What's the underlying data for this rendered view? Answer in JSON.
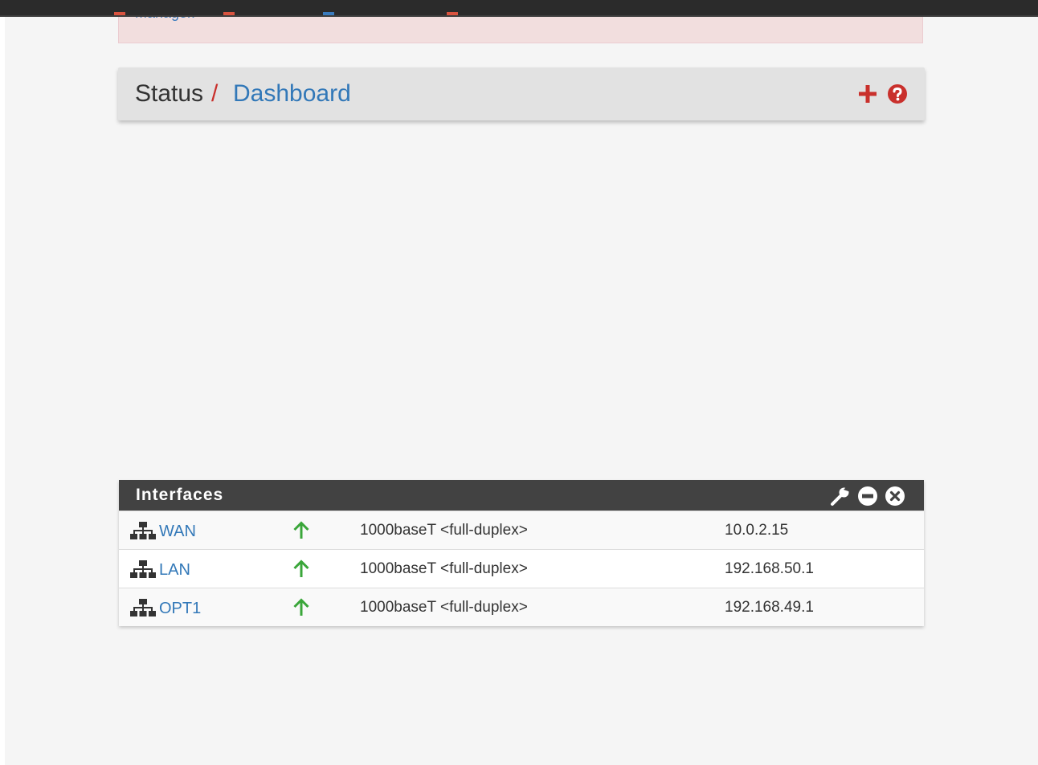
{
  "alert": {
    "text": "Manager."
  },
  "breadcrumb": {
    "section": "Status",
    "separator": "/",
    "page": "Dashboard"
  },
  "colors": {
    "alert_bg": "#f2dede",
    "link_blue": "#3278b8",
    "accent_red": "#c9302c",
    "status_up_green": "#3aa63a",
    "widget_header_bg": "#424242"
  },
  "icons": {
    "add": "plus-icon",
    "help": "question-circle-icon",
    "settings": "wrench-icon",
    "minimize": "minus-circle-icon",
    "close": "close-circle-icon",
    "interface": "sitemap-icon",
    "status_up": "arrow-up-icon"
  },
  "interfaces_widget": {
    "title": "Interfaces",
    "rows": [
      {
        "name": "WAN",
        "status": "up",
        "media": "1000baseT <full-duplex>",
        "ip": "10.0.2.15"
      },
      {
        "name": "LAN",
        "status": "up",
        "media": "1000baseT <full-duplex>",
        "ip": "192.168.50.1"
      },
      {
        "name": "OPT1",
        "status": "up",
        "media": "1000baseT <full-duplex>",
        "ip": "192.168.49.1"
      }
    ]
  }
}
